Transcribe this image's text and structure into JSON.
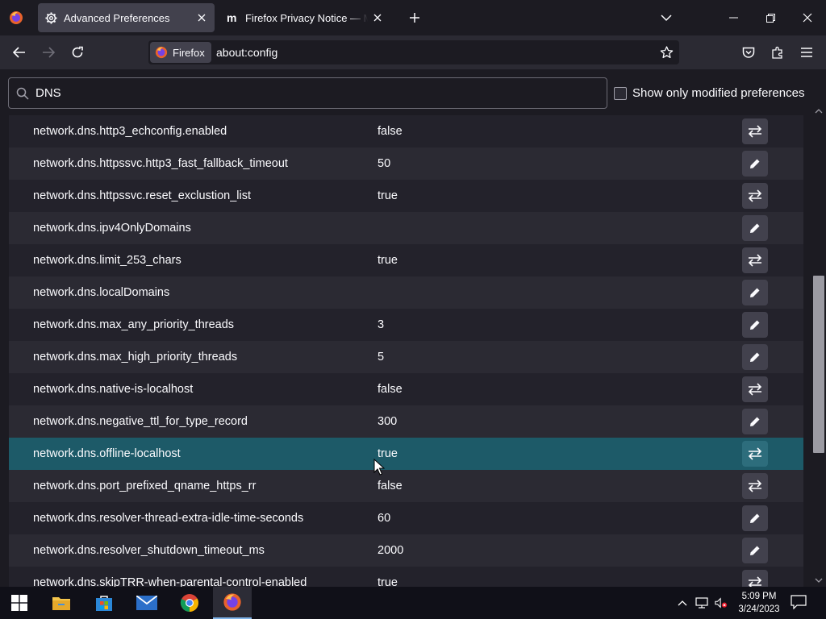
{
  "tabs": [
    {
      "title": "Advanced Preferences",
      "icon": "gear-icon",
      "active": true
    },
    {
      "title": "Firefox Privacy Notice — Mozilla",
      "icon": "mozilla-m-icon",
      "active": false
    }
  ],
  "navbar": {
    "identity_label": "Firefox",
    "url": "about:config"
  },
  "search": {
    "value": "DNS",
    "modified_label": "Show only modified preferences"
  },
  "prefs": [
    {
      "name": "network.dns.http3_echconfig.enabled",
      "value": "false",
      "action": "toggle"
    },
    {
      "name": "network.dns.httpssvc.http3_fast_fallback_timeout",
      "value": "50",
      "action": "edit"
    },
    {
      "name": "network.dns.httpssvc.reset_exclustion_list",
      "value": "true",
      "action": "toggle"
    },
    {
      "name": "network.dns.ipv4OnlyDomains",
      "value": "",
      "action": "edit"
    },
    {
      "name": "network.dns.limit_253_chars",
      "value": "true",
      "action": "toggle"
    },
    {
      "name": "network.dns.localDomains",
      "value": "",
      "action": "edit"
    },
    {
      "name": "network.dns.max_any_priority_threads",
      "value": "3",
      "action": "edit"
    },
    {
      "name": "network.dns.max_high_priority_threads",
      "value": "5",
      "action": "edit"
    },
    {
      "name": "network.dns.native-is-localhost",
      "value": "false",
      "action": "toggle"
    },
    {
      "name": "network.dns.negative_ttl_for_type_record",
      "value": "300",
      "action": "edit"
    },
    {
      "name": "network.dns.offline-localhost",
      "value": "true",
      "action": "toggle",
      "selected": true
    },
    {
      "name": "network.dns.port_prefixed_qname_https_rr",
      "value": "false",
      "action": "toggle"
    },
    {
      "name": "network.dns.resolver-thread-extra-idle-time-seconds",
      "value": "60",
      "action": "edit"
    },
    {
      "name": "network.dns.resolver_shutdown_timeout_ms",
      "value": "2000",
      "action": "edit"
    },
    {
      "name": "network.dns.skipTRR-when-parental-control-enabled",
      "value": "true",
      "action": "toggle"
    }
  ],
  "taskbar": {
    "time": "5:09 PM",
    "date": "3/24/2023"
  },
  "colors": {
    "selected_row": "#1d5a68",
    "accent": "#7fb3e8"
  }
}
